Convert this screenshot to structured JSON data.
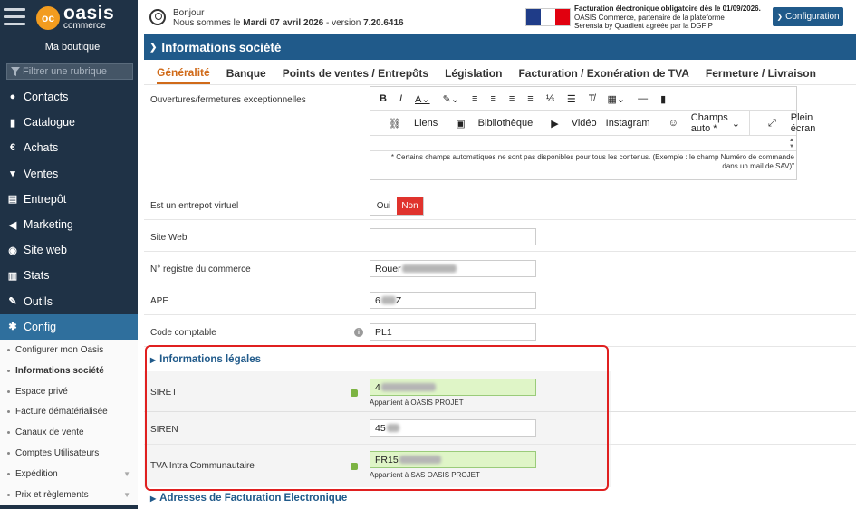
{
  "sidebar": {
    "brand_main": "oasis",
    "brand_sub": "commerce",
    "logo_mark": "oc",
    "shop_name": "Ma boutique",
    "filter_placeholder": "Filtrer une rubrique",
    "items": [
      {
        "label": "Contacts",
        "icon": "person-icon"
      },
      {
        "label": "Catalogue",
        "icon": "book-icon"
      },
      {
        "label": "Achats",
        "icon": "euro-icon"
      },
      {
        "label": "Ventes",
        "icon": "cart-icon"
      },
      {
        "label": "Entrepôt",
        "icon": "warehouse-icon"
      },
      {
        "label": "Marketing",
        "icon": "megaphone-icon"
      },
      {
        "label": "Site web",
        "icon": "globe-icon"
      },
      {
        "label": "Stats",
        "icon": "chart-icon"
      },
      {
        "label": "Outils",
        "icon": "wrench-icon"
      },
      {
        "label": "Config",
        "icon": "gear-icon"
      }
    ],
    "subitems": [
      "Configurer mon Oasis",
      "Informations société",
      "Espace privé",
      "Facture dématérialisée",
      "Canaux de vente",
      "Comptes Utilisateurs",
      "Expédition",
      "Prix et règlements"
    ]
  },
  "topbar": {
    "greeting": "Bonjour",
    "status_prefix": "Nous sommes le ",
    "date": "Mardi 07 avril 2026",
    "version_prefix": " - version ",
    "version": "7.20.6416",
    "notice_line1": "Facturation électronique obligatoire dès le 01/09/2026.",
    "notice_line2": "OASIS Commerce, partenaire de la plateforme",
    "notice_line3": "Serensia by Quadient agréée par la DGFIP",
    "config_button": "Configuration"
  },
  "page": {
    "title": "Informations société",
    "tabs": [
      "Généralité",
      "Banque",
      "Points de ventes / Entrepôts",
      "Législation",
      "Facturation / Exonération de TVA",
      "Fermeture / Livraison"
    ]
  },
  "editor": {
    "row_label": "Ouvertures/fermetures exceptionnelles",
    "btn_links": "Liens",
    "btn_library": "Bibliothèque",
    "btn_video": "Vidéo",
    "btn_instagram": "Instagram",
    "btn_champs": "Champs auto *",
    "btn_fullscreen": "Plein écran",
    "hint_line1": "* Certains champs automatiques ne sont pas disponibles pour tous les contenus. (Exemple : le champ Numéro de commande",
    "hint_line2": "dans un mail de SAV)\""
  },
  "fields": {
    "virtual_label": "Est un entrepot virtuel",
    "oui": "Oui",
    "non": "Non",
    "website_label": "Site Web",
    "website_value": "",
    "rc_label": "N° registre du commerce",
    "rc_value": "Rouer",
    "ape_label": "APE",
    "ape_value_start": "6",
    "ape_value_end": "Z",
    "compta_label": "Code comptable",
    "compta_value": "PL1"
  },
  "legal": {
    "section_title": "Informations légales",
    "siret_label": "SIRET",
    "siret_value": "4",
    "siret_note": "Appartient à OASIS PROJET",
    "siren_label": "SIREN",
    "siren_value": "45",
    "tva_label": "TVA Intra Communautaire",
    "tva_value": "FR15",
    "tva_note": "Appartient à SAS OASIS PROJET"
  },
  "next_section": {
    "title": "Adresses de Facturation Electronique"
  },
  "colors": {
    "sidebar_bg": "#1f3246",
    "accent_blue": "#205a8a",
    "tab_active": "#d06a19",
    "non_red": "#e0332d",
    "valid_green": "#dff5c7",
    "highlight_red": "#e02020"
  }
}
